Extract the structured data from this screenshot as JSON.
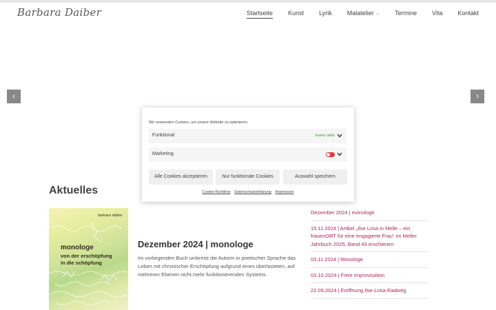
{
  "header": {
    "logo_text": "Barbara Daiber",
    "nav": [
      {
        "label": "Startseite",
        "active": true
      },
      {
        "label": "Kunst"
      },
      {
        "label": "Lyrik"
      },
      {
        "label": "Malatelier",
        "has_dropdown": true
      },
      {
        "label": "Termine"
      },
      {
        "label": "Vita"
      },
      {
        "label": "Kontakt"
      }
    ]
  },
  "slider": {
    "prev_icon": "‹",
    "next_icon": "›"
  },
  "main": {
    "section_title": "Aktuelles",
    "book": {
      "author": "barbara daiber",
      "title": "monologe",
      "subtitle_line1": "von der erschöpfung",
      "subtitle_line2": "in die schöpfung"
    },
    "post": {
      "title": "Dezember 2024 | monologe",
      "excerpt": "Im vorliegenden Buch umkreist die Autorin in poetischer Sprache das Leben mit chronischer Erschöpfung aufgrund eines überlasteten, auf mehreren Ebenen nicht mehr funktionierenden Systems."
    },
    "news": [
      "Dezember 2024 | monologe",
      "15.11.2024 | Artikel „Ilse Losa in Melle – ein frauenORT für eine engagierte Frau“ im Meller Jahrbuch 2025, Band 43 erschienen",
      "03.11.2024 | Monologe",
      "03.10.2024 | Freie Improvisation",
      "22.09.2024 | Eröffnung Ilse-Losa-Radweg"
    ]
  },
  "cookie": {
    "message": "Wir verwenden Cookies, um unsere Website zu optimieren.",
    "rows": [
      {
        "label": "Funktional",
        "status": "Immer aktiv"
      },
      {
        "label": "Marketing",
        "toggle_on": false
      }
    ],
    "buttons": {
      "accept_all": "Alle Cookies akzeptieren",
      "functional_only": "Nur funktionale Cookies",
      "save": "Auswahl speichern"
    },
    "links": {
      "cookie_policy": "Cookie-Richtlinie",
      "privacy": "Datenschutzerklärung",
      "imprint": "Impressum"
    }
  },
  "colors": {
    "accent_link": "#b0245a",
    "toggle": "#e6393f",
    "status_green": "#3c9a3c"
  }
}
